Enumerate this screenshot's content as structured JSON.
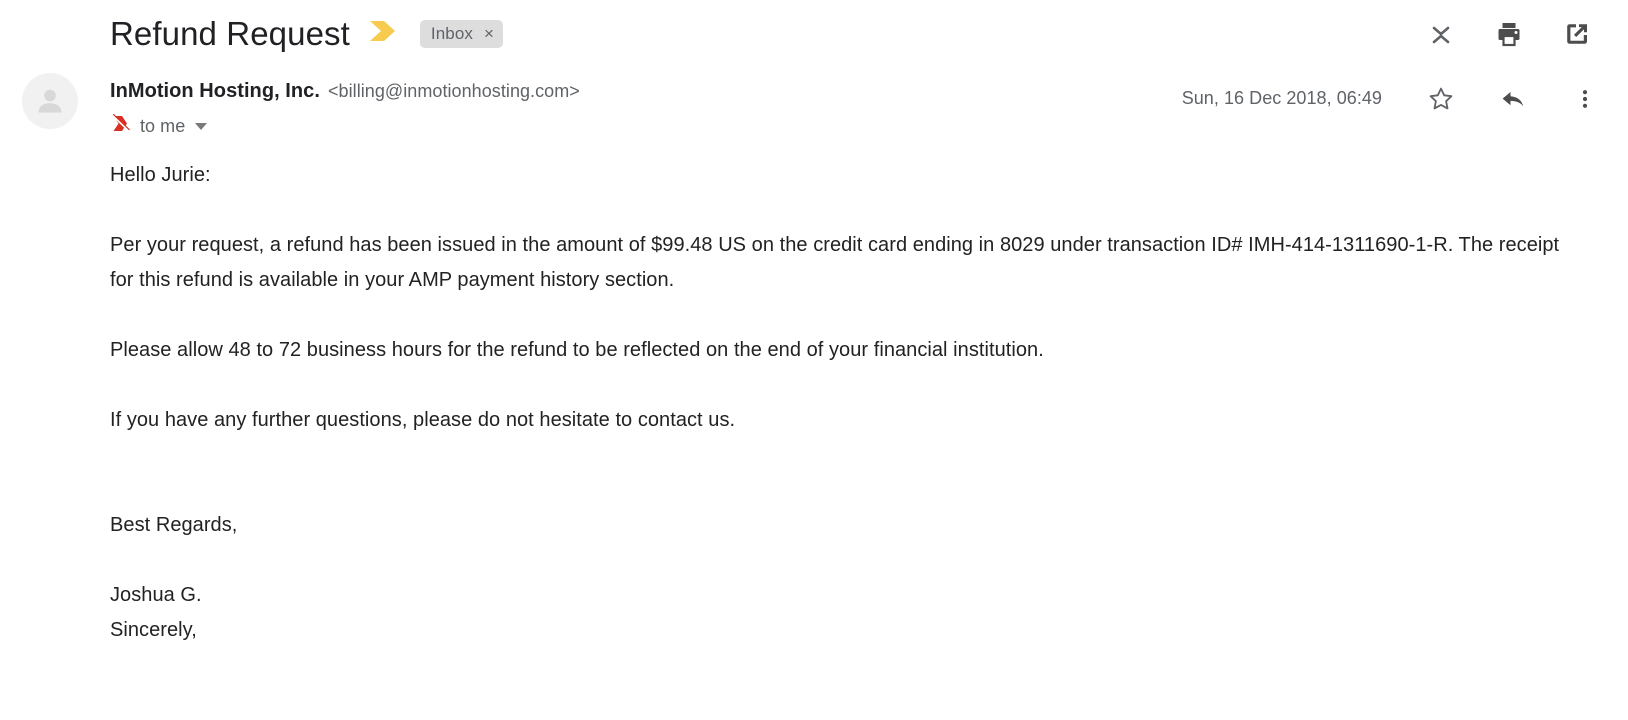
{
  "header": {
    "subject": "Refund Request",
    "importance_icon": "importance-chevron-icon",
    "label": {
      "name": "Inbox",
      "remove_glyph": "×"
    },
    "actions": [
      {
        "name": "collapse-all-button",
        "icon": "collapse-all-icon"
      },
      {
        "name": "print-all-button",
        "icon": "printer-icon"
      },
      {
        "name": "open-in-new-window-button",
        "icon": "external-link-icon"
      }
    ]
  },
  "message": {
    "avatar_icon": "default-person-avatar-icon",
    "sender_name": "InMotion Hosting, Inc.",
    "sender_email": "<billing@inmotionhosting.com>",
    "important_marker_icon": "important-marker-icon",
    "recipient": "to me",
    "details_caret_icon": "chevron-down-icon",
    "timestamp": "Sun, 16 Dec 2018, 06:49",
    "star_icon": "star-outline-icon",
    "reply_icon": "reply-arrow-icon",
    "more_icon": "more-vertical-icon",
    "body": {
      "greeting": "Hello Jurie:",
      "paragraph_1": "Per your request, a refund has been issued in the amount of $99.48 US on the credit card ending in 8029 under transaction ID# IMH-414-1311690-1-R. The receipt for this refund is available in your AMP payment history section.",
      "paragraph_2": "Please allow 48 to 72 business hours for the refund to be reflected on the end of your financial institution.",
      "paragraph_3": "If you have any further questions, please do not hesitate to contact us.",
      "closing": "Best Regards,",
      "signer": "Joshua G.",
      "signoff": "Sincerely,"
    }
  },
  "colors": {
    "importance_yellow": "#f7cb4d",
    "label_chip_bg": "#ddddde",
    "text_primary": "#202124",
    "text_secondary": "#5f6368",
    "important_marker_red": "#d93025"
  }
}
